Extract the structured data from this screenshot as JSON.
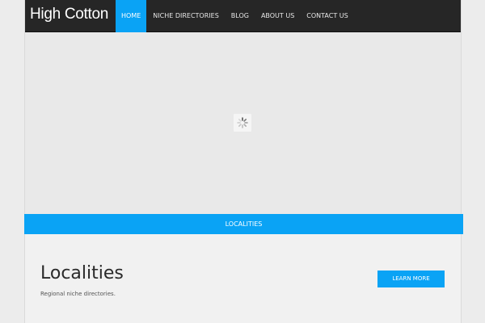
{
  "site": {
    "title": "High Cotton"
  },
  "nav": {
    "items": [
      {
        "label": "HOME",
        "active": true
      },
      {
        "label": "NICHE DIRECTORIES",
        "active": false
      },
      {
        "label": "BLOG",
        "active": false
      },
      {
        "label": "ABOUT US",
        "active": false
      },
      {
        "label": "CONTACT US",
        "active": false
      }
    ]
  },
  "slider": {
    "caption": "LOCALITIES"
  },
  "section": {
    "title": "Localities",
    "description": "Regional niche directories.",
    "button_label": "LEARN MORE"
  },
  "colors": {
    "accent": "#0aa3f5",
    "navbar": "#262626"
  },
  "icons": {
    "loader": "spinner-icon"
  }
}
